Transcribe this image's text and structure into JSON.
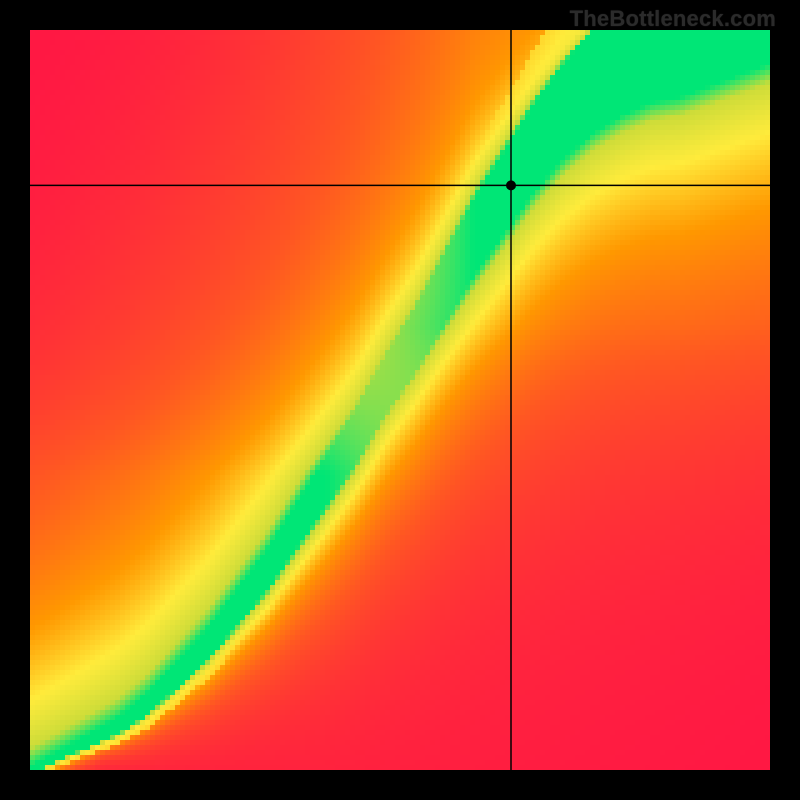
{
  "watermark": "TheBottleneck.com",
  "chart_data": {
    "type": "heatmap",
    "title": "",
    "xlabel": "",
    "ylabel": "",
    "xlim": [
      0,
      1
    ],
    "ylim": [
      0,
      1
    ],
    "crosshair": {
      "x": 0.65,
      "y": 0.79
    },
    "marker": {
      "x": 0.65,
      "y": 0.79
    },
    "optimal_ridge": [
      [
        0.0,
        0.0
      ],
      [
        0.04,
        0.02
      ],
      [
        0.08,
        0.04
      ],
      [
        0.12,
        0.06
      ],
      [
        0.16,
        0.09
      ],
      [
        0.2,
        0.13
      ],
      [
        0.24,
        0.17
      ],
      [
        0.28,
        0.22
      ],
      [
        0.32,
        0.27
      ],
      [
        0.36,
        0.33
      ],
      [
        0.4,
        0.39
      ],
      [
        0.44,
        0.45
      ],
      [
        0.48,
        0.52
      ],
      [
        0.52,
        0.58
      ],
      [
        0.56,
        0.65
      ],
      [
        0.6,
        0.72
      ],
      [
        0.64,
        0.78
      ],
      [
        0.68,
        0.84
      ],
      [
        0.72,
        0.89
      ],
      [
        0.76,
        0.93
      ],
      [
        0.8,
        0.96
      ],
      [
        0.84,
        0.985
      ],
      [
        0.88,
        1.0
      ]
    ],
    "ridge_width": [
      [
        0.0,
        0.004
      ],
      [
        0.1,
        0.01
      ],
      [
        0.2,
        0.018
      ],
      [
        0.3,
        0.026
      ],
      [
        0.4,
        0.034
      ],
      [
        0.5,
        0.042
      ],
      [
        0.6,
        0.052
      ],
      [
        0.7,
        0.062
      ],
      [
        0.8,
        0.075
      ],
      [
        0.88,
        0.09
      ]
    ],
    "color_scale": [
      {
        "stop": 0.0,
        "color": "#ff1744",
        "meaning": "severe-bottleneck"
      },
      {
        "stop": 0.3,
        "color": "#ff5722",
        "meaning": "high-bottleneck"
      },
      {
        "stop": 0.55,
        "color": "#ff9800",
        "meaning": "moderate"
      },
      {
        "stop": 0.75,
        "color": "#ffeb3b",
        "meaning": "near-balanced"
      },
      {
        "stop": 0.92,
        "color": "#cddc39",
        "meaning": "good"
      },
      {
        "stop": 1.0,
        "color": "#00e676",
        "meaning": "balanced"
      }
    ]
  }
}
